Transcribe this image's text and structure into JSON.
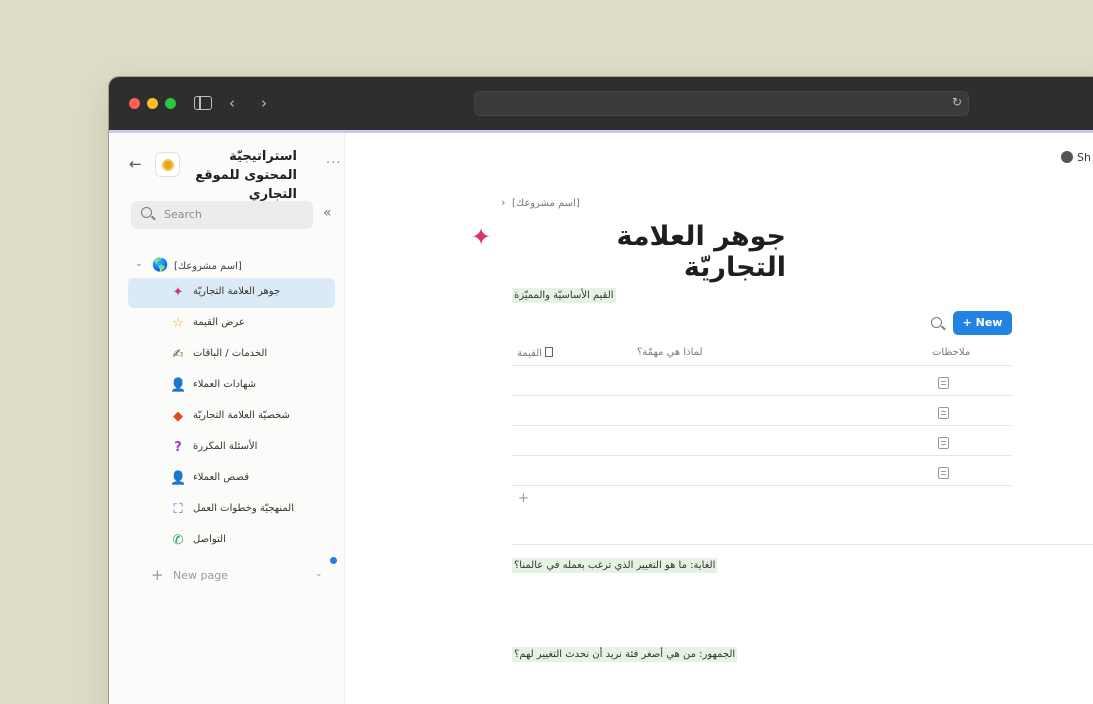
{
  "browser": {
    "url": ""
  },
  "workspace": {
    "title": "استراتيجيّة المحتوى للموقع التجاري",
    "more": "···"
  },
  "sidebar": {
    "search_placeholder": "Search",
    "collapse": "«",
    "root": {
      "label": "[اسم مشروعك]",
      "icon": "🌎"
    },
    "items": [
      {
        "label": "جوهر العلامة التجاريّة",
        "icon": "✦",
        "color": "#d6336c",
        "active": true
      },
      {
        "label": "عرض القيمة",
        "icon": "☆",
        "color": "#e3b500"
      },
      {
        "label": "الخدمات / الباقات",
        "icon": "✍",
        "color": "#7a5c2e"
      },
      {
        "label": "شهادات العملاء",
        "icon": "👤",
        "color": "#c98c4a"
      },
      {
        "label": "شخصيّة العلامة التجاريّة",
        "icon": "◆",
        "color": "#e04b1e"
      },
      {
        "label": "الأسئلة المكررة",
        "icon": "?",
        "color": "#a33bd1"
      },
      {
        "label": "قصص العملاء",
        "icon": "👤",
        "color": "#c98c4a"
      },
      {
        "label": "المنهجيّة وخطوات العمل",
        "icon": "⛶",
        "color": "#a33bd1"
      },
      {
        "label": "التواصل",
        "icon": "✆",
        "color": "#1a9c5b"
      }
    ],
    "new_page": "New page",
    "plus": "+",
    "chevron": "⌄"
  },
  "main": {
    "share": "Sh",
    "breadcrumb": "[اسم مشروعك]",
    "breadcrumb_chev": "›",
    "title": "جوهر العلامة التجاريّة",
    "title_icon": "✦",
    "database": {
      "title": "القيم الأساسيّة والمميّزة",
      "new_button": "+ New",
      "columns": [
        "القيمة",
        "لماذا هي مهمّة؟",
        "ملاحظات"
      ],
      "row_count": 4,
      "add_row": "+"
    },
    "questions": [
      "الغاية: ما هو التغيير الذي ترغب بعمله في عالمنا؟",
      "الجمهور: من هي أصغر فئة نريد أن نحدث التغيير لهم؟"
    ]
  }
}
